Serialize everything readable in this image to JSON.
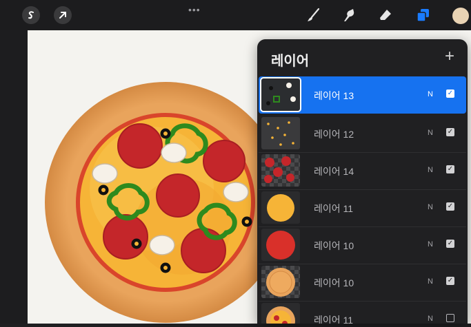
{
  "toolbar": {
    "gallery_icon": "s-curve-icon",
    "transform_icon": "arrow-icon",
    "more_label": "•••",
    "tools": [
      "brush-icon",
      "smudge-icon",
      "eraser-icon",
      "layers-icon"
    ],
    "active_tool": "layers-icon",
    "current_color": "#e9d3b4",
    "accent": "#1672f0"
  },
  "layers_panel": {
    "title": "레이어",
    "add_label": "+",
    "layers": [
      {
        "name": "레이어 13",
        "blend": "N",
        "visible": true,
        "active": true,
        "check": "✓"
      },
      {
        "name": "레이어 12",
        "blend": "N",
        "visible": true,
        "active": false,
        "check": "✓"
      },
      {
        "name": "레이어 14",
        "blend": "N",
        "visible": true,
        "active": false,
        "check": "✓"
      },
      {
        "name": "레이어 11",
        "blend": "N",
        "visible": true,
        "active": false,
        "check": "✓"
      },
      {
        "name": "레이어 10",
        "blend": "N",
        "visible": true,
        "active": false,
        "check": "✓"
      },
      {
        "name": "레이어 10",
        "blend": "N",
        "visible": true,
        "active": false,
        "check": "✓"
      },
      {
        "name": "레이어 11",
        "blend": "N",
        "visible": false,
        "active": false,
        "check": ""
      }
    ]
  }
}
